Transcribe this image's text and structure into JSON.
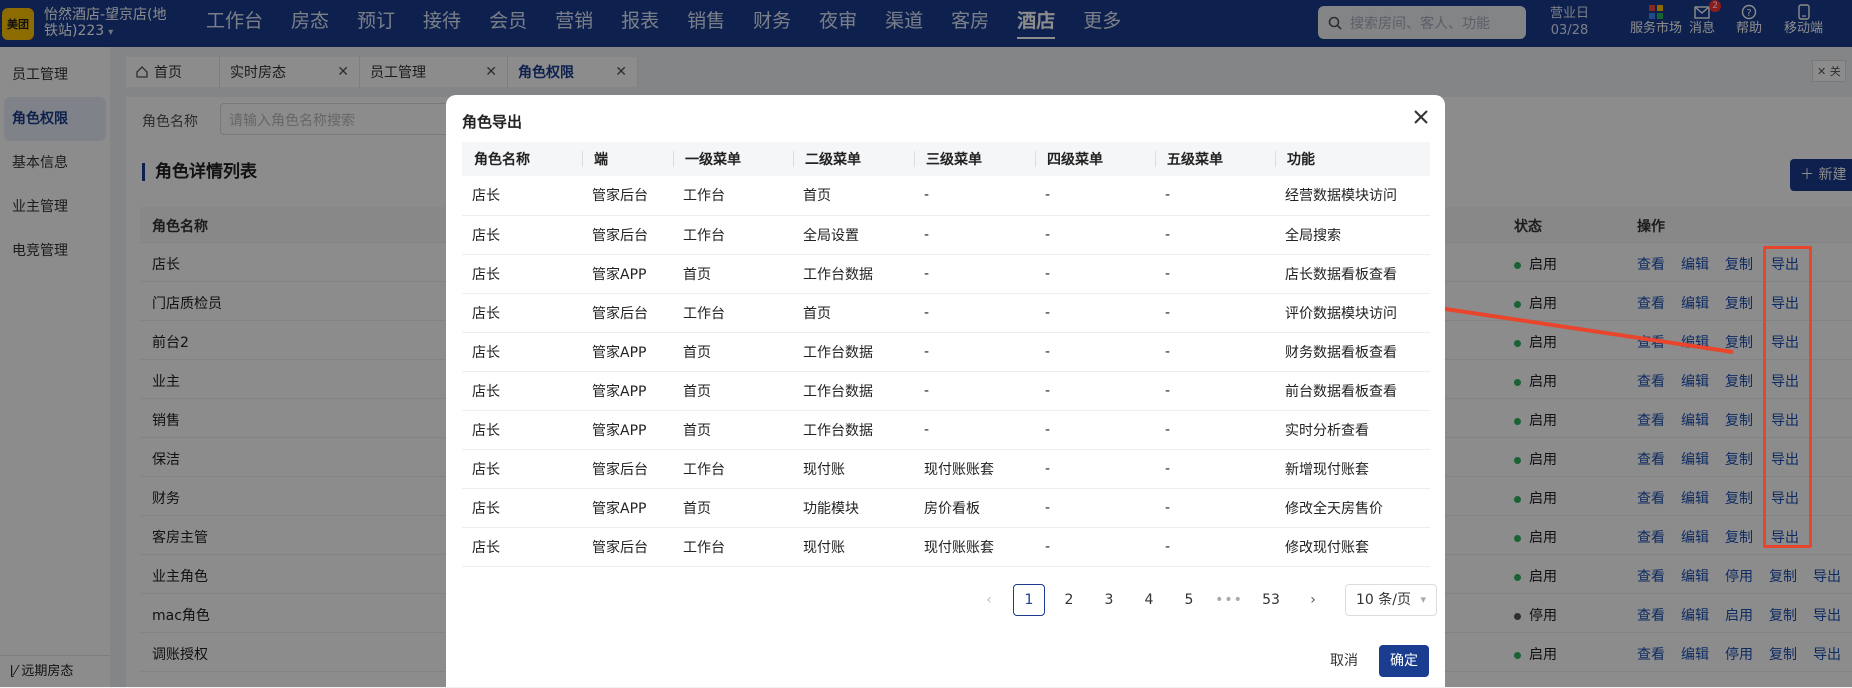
{
  "topbar": {
    "logo": "美团",
    "store_name": "怡然酒店-望京店(地铁站)223",
    "nav": [
      "工作台",
      "房态",
      "预订",
      "接待",
      "会员",
      "营销",
      "报表",
      "销售",
      "财务",
      "夜审",
      "渠道",
      "客房",
      "酒店",
      "更多"
    ],
    "active_nav": "酒店",
    "search_placeholder": "搜索房间、客人、功能",
    "bizday_label": "营业日",
    "bizday_value": "03/28",
    "icons": [
      {
        "label": "服务市场",
        "icon": "grid-colorful-icon"
      },
      {
        "label": "消息",
        "icon": "mail-icon",
        "badge": "2"
      },
      {
        "label": "帮助",
        "icon": "help-icon"
      },
      {
        "label": "移动端",
        "icon": "mobile-icon"
      }
    ]
  },
  "sidebar": {
    "items": [
      "员工管理",
      "角色权限",
      "基本信息",
      "业主管理",
      "电竞管理"
    ],
    "active": "角色权限",
    "bottom": "远期房态"
  },
  "tabs": [
    {
      "label": "首页",
      "icon": "home-icon"
    },
    {
      "label": "实时房态",
      "closable": true
    },
    {
      "label": "员工管理",
      "closable": true
    },
    {
      "label": "角色权限",
      "closable": true,
      "active": true
    }
  ],
  "close_all": "关",
  "main": {
    "filter_label": "角色名称",
    "filter_placeholder": "请输入角色名称搜索",
    "section_title": "角色详情列表",
    "new_button": "新建",
    "columns": {
      "name": "角色名称",
      "status": "状态",
      "ops": "操作"
    },
    "rows": [
      {
        "name": "店长",
        "status": "启用",
        "on": true,
        "ops": [
          "查看",
          "编辑",
          "复制",
          "导出"
        ]
      },
      {
        "name": "门店质检员",
        "status": "启用",
        "on": true,
        "ops": [
          "查看",
          "编辑",
          "复制",
          "导出"
        ]
      },
      {
        "name": "前台2",
        "status": "启用",
        "on": true,
        "ops": [
          "查看",
          "编辑",
          "复制",
          "导出"
        ]
      },
      {
        "name": "业主",
        "status": "启用",
        "on": true,
        "ops": [
          "查看",
          "编辑",
          "复制",
          "导出"
        ]
      },
      {
        "name": "销售",
        "status": "启用",
        "on": true,
        "ops": [
          "查看",
          "编辑",
          "复制",
          "导出"
        ]
      },
      {
        "name": "保洁",
        "status": "启用",
        "on": true,
        "ops": [
          "查看",
          "编辑",
          "复制",
          "导出"
        ]
      },
      {
        "name": "财务",
        "status": "启用",
        "on": true,
        "ops": [
          "查看",
          "编辑",
          "复制",
          "导出"
        ]
      },
      {
        "name": "客房主管",
        "status": "启用",
        "on": true,
        "ops": [
          "查看",
          "编辑",
          "复制",
          "导出"
        ]
      },
      {
        "name": "业主角色",
        "status": "启用",
        "on": true,
        "ops": [
          "查看",
          "编辑",
          "停用",
          "复制",
          "导出"
        ]
      },
      {
        "name": "mac角色",
        "status": "停用",
        "on": false,
        "ops": [
          "查看",
          "编辑",
          "启用",
          "复制",
          "导出"
        ]
      },
      {
        "name": "调账授权",
        "status": "启用",
        "on": true,
        "ops": [
          "查看",
          "编辑",
          "停用",
          "复制",
          "导出"
        ]
      }
    ]
  },
  "modal": {
    "title": "角色导出",
    "columns": [
      "角色名称",
      "端",
      "一级菜单",
      "二级菜单",
      "三级菜单",
      "四级菜单",
      "五级菜单",
      "功能"
    ],
    "rows": [
      [
        "店长",
        "管家后台",
        "工作台",
        "首页",
        "-",
        "-",
        "-",
        "经营数据模块访问"
      ],
      [
        "店长",
        "管家后台",
        "工作台",
        "全局设置",
        "-",
        "-",
        "-",
        "全局搜索"
      ],
      [
        "店长",
        "管家APP",
        "首页",
        "工作台数据",
        "-",
        "-",
        "-",
        "店长数据看板查看"
      ],
      [
        "店长",
        "管家后台",
        "工作台",
        "首页",
        "-",
        "-",
        "-",
        "评价数据模块访问"
      ],
      [
        "店长",
        "管家APP",
        "首页",
        "工作台数据",
        "-",
        "-",
        "-",
        "财务数据看板查看"
      ],
      [
        "店长",
        "管家APP",
        "首页",
        "工作台数据",
        "-",
        "-",
        "-",
        "前台数据看板查看"
      ],
      [
        "店长",
        "管家APP",
        "首页",
        "工作台数据",
        "-",
        "-",
        "-",
        "实时分析查看"
      ],
      [
        "店长",
        "管家后台",
        "工作台",
        "现付账",
        "现付账账套",
        "-",
        "-",
        "新增现付账套"
      ],
      [
        "店长",
        "管家APP",
        "首页",
        "功能模块",
        "房价看板",
        "-",
        "-",
        "修改全天房售价"
      ],
      [
        "店长",
        "管家后台",
        "工作台",
        "现付账",
        "现付账账套",
        "-",
        "-",
        "修改现付账套"
      ]
    ],
    "pager": {
      "prev": "‹",
      "pages": [
        "1",
        "2",
        "3",
        "4",
        "5"
      ],
      "current": "1",
      "ellipsis": "•••",
      "last": "53",
      "next": "›",
      "page_size": "10 条/页"
    },
    "cancel": "取消",
    "ok": "确定"
  },
  "colors": {
    "nav": "#1a3d8f",
    "accent": "#1a3d8f",
    "annotation": "#e8452c",
    "enabled": "#2bb55a"
  }
}
